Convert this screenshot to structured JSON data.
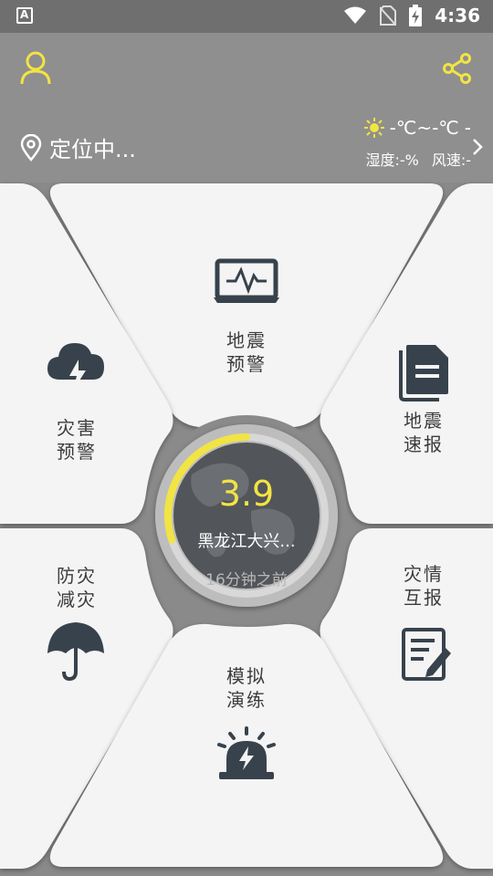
{
  "status_bar": {
    "time": "4:36",
    "left_icon": "a-badge-icon",
    "icons": [
      "wifi-icon",
      "no-sim-icon",
      "battery-charging-icon"
    ]
  },
  "header": {
    "location": "定位中...",
    "weather": {
      "temperature": "-℃~-℃",
      "condition": "-",
      "humidity": "湿度:-%",
      "wind": "风速:-"
    }
  },
  "tiles": {
    "earthquake_warning": "地震\n预警",
    "disaster_warning": "灾害\n预警",
    "earthquake_report": "地震\n速报",
    "prevention": "防灾\n减灾",
    "disaster_exchange": "灾情\n互报",
    "simulation_drill": "模拟\n演练"
  },
  "center": {
    "magnitude": "3.9",
    "location": "黑龙江大兴...",
    "time_ago": "16分钟之前",
    "progress": 0.3
  },
  "colors": {
    "accent": "#f2e443",
    "header_bg": "#8f8f8f",
    "tile_bg": "#f4f4f4",
    "icon": "#37424c"
  }
}
